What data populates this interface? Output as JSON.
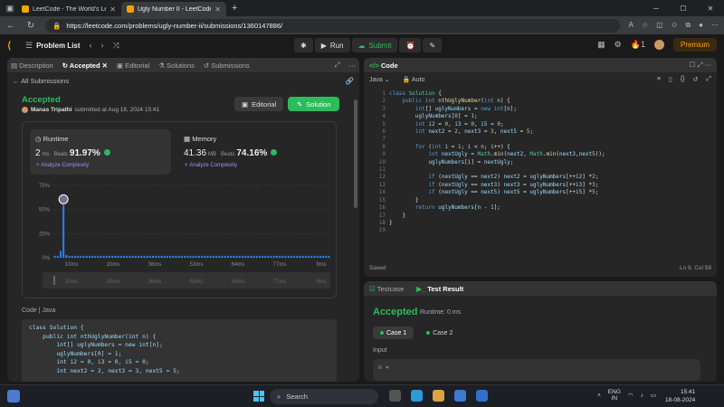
{
  "browser": {
    "tabs": [
      {
        "title": "LeetCode - The World's Leading",
        "active": false
      },
      {
        "title": "Ugly Number II - LeetCode",
        "active": true
      }
    ],
    "url": "https://leetcode.com/problems/ugly-number-ii/submissions/1360147886/"
  },
  "nav": {
    "problem_list": "Problem List",
    "run": "Run",
    "submit": "Submit",
    "streak": "1",
    "premium": "Premium"
  },
  "left": {
    "tabs": [
      "Description",
      "Accepted",
      "Editorial",
      "Solutions",
      "Submissions"
    ],
    "all_submissions": "All Submissions",
    "status": "Accepted",
    "author": "Manas Tripathi",
    "submitted_at": "submitted at Aug 18, 2024 15:41",
    "editorial_btn": "Editorial",
    "solution_btn": "Solution",
    "runtime": {
      "title": "Runtime",
      "value": "2",
      "unit": "ms",
      "beats_label": "Beats",
      "beats": "91.97%",
      "analyze": "Analyze Complexity"
    },
    "memory": {
      "title": "Memory",
      "value": "41.36",
      "unit": "MB",
      "beats_label": "Beats",
      "beats": "74.16%",
      "analyze": "Analyze Complexity"
    },
    "code_label": "Code",
    "code_lang": "Java",
    "code_lines": [
      "class Solution {",
      "    public int nthUglyNumber(int n) {",
      "        int[] uglyNumbers = new int[n];",
      "        uglyNumbers[0] = 1;",
      "        int i2 = 0, i3 = 0, i5 = 0;",
      "        int next2 = 2, next3 = 3, next5 = 5;"
    ]
  },
  "chart_data": {
    "type": "bar",
    "title": "",
    "xlabel": "",
    "ylabel": "",
    "yticks": [
      "75%",
      "50%",
      "25%",
      "0%"
    ],
    "ylim": [
      0,
      75
    ],
    "xticks": [
      "10ms",
      "20ms",
      "36ms",
      "53ms",
      "64ms",
      "77ms",
      "9ms"
    ],
    "x": [
      0,
      1,
      2,
      3,
      4,
      5,
      6,
      7,
      8,
      9,
      10,
      11,
      12,
      13,
      14,
      15,
      16,
      17,
      18,
      19,
      20,
      21,
      22,
      23,
      24,
      25,
      26,
      27,
      28,
      29,
      30,
      31,
      32,
      33,
      34,
      35,
      36,
      37,
      38,
      39,
      40,
      41,
      42,
      43,
      44,
      45,
      46,
      47,
      48,
      49,
      50,
      51,
      52,
      53,
      54,
      55,
      56,
      57,
      58,
      59,
      60,
      61,
      62,
      63,
      64,
      65,
      66,
      67,
      68,
      69,
      70,
      71,
      72,
      73,
      74,
      75,
      76,
      77,
      78,
      79,
      80,
      81,
      82,
      83,
      84,
      85,
      86,
      87,
      88,
      89,
      90,
      91,
      92,
      93,
      94,
      95
    ],
    "values": [
      2,
      2,
      7,
      55,
      3,
      2,
      2,
      2,
      2,
      2,
      2,
      2,
      2,
      2,
      2,
      2,
      2,
      2,
      2,
      2,
      2,
      2,
      2,
      2,
      2,
      2,
      2,
      2,
      2,
      2,
      2,
      2,
      2,
      2,
      2,
      2,
      2,
      2,
      2,
      2,
      2,
      2,
      2,
      2,
      2,
      2,
      2,
      2,
      2,
      2,
      2,
      2,
      2,
      2,
      2,
      2,
      2,
      2,
      2,
      2,
      2,
      2,
      2,
      2,
      2,
      2,
      2,
      2,
      2,
      2,
      2,
      2,
      2,
      2,
      2,
      2,
      2,
      2,
      2,
      2,
      2,
      2,
      2,
      2,
      2,
      2,
      2,
      2,
      2,
      2,
      2,
      2,
      2,
      2,
      2,
      2
    ],
    "highlight_index": 3,
    "bar_color": "#2d7ff9",
    "grid": true
  },
  "code": {
    "title": "Code",
    "lang": "Java",
    "mode": "Auto",
    "saved": "Saved",
    "position": "Ln 9, Col 59",
    "line_numbers": [
      "1",
      "2",
      "3",
      "4",
      "5",
      "6",
      "7",
      "8",
      "9",
      "10",
      "11",
      "12",
      "13",
      "14",
      "15",
      "16",
      "17",
      "18",
      "19"
    ]
  },
  "test": {
    "tab1": "Testcase",
    "tab2": "Test Result",
    "status": "Accepted",
    "runtime": "Runtime: 0 ms",
    "cases": [
      "Case 1",
      "Case 2"
    ],
    "input_label": "Input",
    "input_value": "n ="
  },
  "taskbar": {
    "search": "Search",
    "lang1": "ENG",
    "lang2": "IN",
    "time": "15:41",
    "date": "18-08-2024"
  },
  "colors": {
    "accent": "#2cbb5d",
    "brand": "#ffa116",
    "bar": "#2d7ff9"
  }
}
